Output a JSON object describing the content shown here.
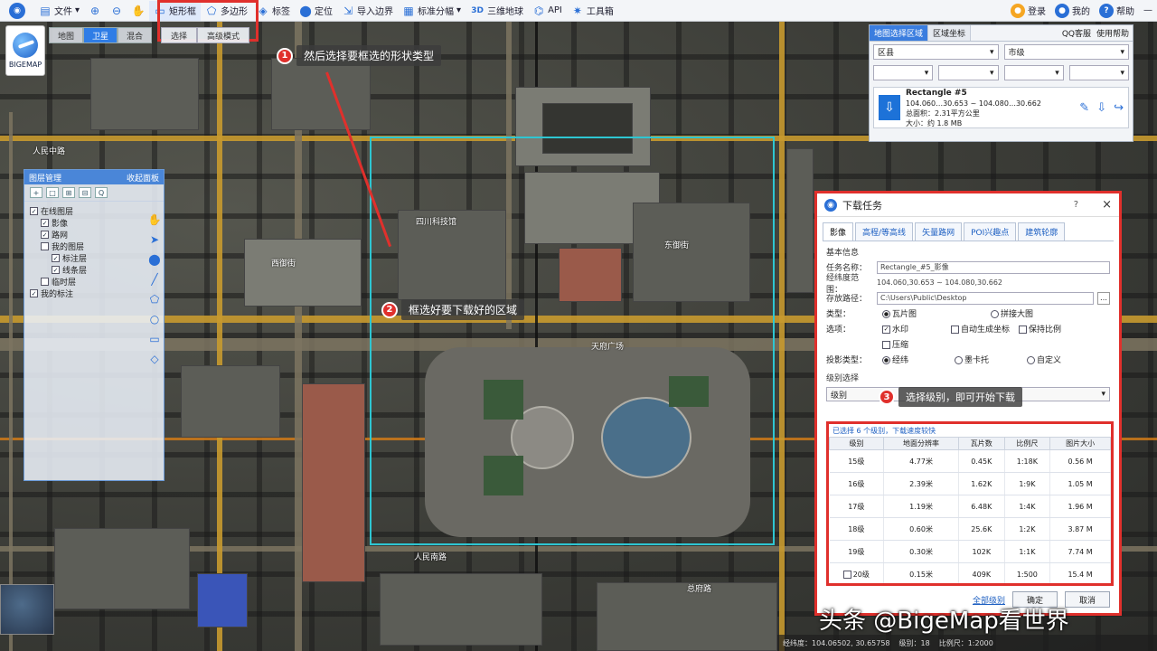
{
  "toolbar": {
    "items": [
      {
        "label": "文件",
        "icon": "folder-icon"
      },
      {
        "label": "",
        "icon": "zoom-in-icon"
      },
      {
        "label": "",
        "icon": "zoom-out-icon"
      },
      {
        "label": "",
        "icon": "hand-icon"
      },
      {
        "label": "矩形框",
        "icon": "rectangle-select-icon"
      },
      {
        "label": "多边形",
        "icon": "polygon-select-icon"
      },
      {
        "label": "标签",
        "icon": "tag-icon"
      },
      {
        "label": "定位",
        "icon": "location-icon"
      },
      {
        "label": "导入边界",
        "icon": "import-icon"
      },
      {
        "label": "标准分幅",
        "icon": "grid-icon"
      },
      {
        "label": "三维地球",
        "icon": "3d-icon"
      },
      {
        "label": "API",
        "icon": "api-icon"
      },
      {
        "label": "工具箱",
        "icon": "toolbox-icon"
      }
    ],
    "right": [
      {
        "label": "登录",
        "color": "#f5a623"
      },
      {
        "label": "我的",
        "color": "#2a6fd6"
      },
      {
        "label": "帮助",
        "color": "#2a6fd6"
      }
    ]
  },
  "maptype_tabs": [
    "地图",
    "卫星",
    "混合"
  ],
  "subtabs": [
    "选择",
    "高级模式"
  ],
  "logo": {
    "label": "BIGEMAP"
  },
  "callouts": {
    "c1": {
      "num": "1",
      "text": "然后选择要框选的形状类型"
    },
    "c2": {
      "num": "2",
      "text": "框选好要下载好的区域"
    },
    "c3": {
      "num": "3",
      "text": "选择级别，即可开始下载"
    }
  },
  "layer_panel": {
    "title": "图层管理",
    "right": "收起面板",
    "tools": [
      "+",
      "□",
      "⊞",
      "⊟",
      "Q"
    ],
    "tree": [
      {
        "label": "在线图层",
        "checked": true,
        "indent": 0
      },
      {
        "label": "影像",
        "checked": true,
        "indent": 1
      },
      {
        "label": "路网",
        "checked": true,
        "indent": 1
      },
      {
        "label": "我的图层",
        "checked": false,
        "indent": 1
      },
      {
        "label": "标注层",
        "checked": true,
        "indent": 2
      },
      {
        "label": "线条层",
        "checked": true,
        "indent": 2
      },
      {
        "label": "临时层",
        "checked": false,
        "indent": 1
      },
      {
        "label": "我的标注",
        "checked": true,
        "indent": 0
      }
    ]
  },
  "info_panel": {
    "tabs": [
      "地图选择区域",
      "区域坐标"
    ],
    "qq": "QQ客服",
    "help": "使用帮助",
    "sel1": "区县",
    "sel2": "市级",
    "file_title": "Rectangle #5",
    "file_line1": "104.060…30.653 ~ 104.080…30.662",
    "file_line2": "总面积：2.31平方公里",
    "file_line3": "大小：约 1.8 MB"
  },
  "dialog": {
    "title": "下载任务",
    "help": "?",
    "close": "×",
    "tabs": [
      "影像",
      "高程/等高线",
      "矢量路网",
      "POI兴趣点",
      "建筑轮廓"
    ],
    "section1": "基本信息",
    "name_label": "任务名称：",
    "name_value": "Rectangle_#5_影像",
    "range_label": "经纬度范围：",
    "range_value": "104.060,30.653 ~ 104.080,30.662",
    "path_label": "存放路径：",
    "path_value": "C:\\Users\\Public\\Desktop",
    "type_label": "类型：",
    "type_a": "瓦片图",
    "type_b": "拼接大图",
    "opt_label": "选项：",
    "opt_a": "水印",
    "opt_b": "自动生成坐标",
    "opt_c": "保持比例",
    "opt_d": "压缩",
    "proj_label": "投影类型：",
    "proj_a": "经纬",
    "proj_b": "墨卡托",
    "proj_c": "自定义",
    "section2": "级别选择",
    "level_combo": "级别",
    "note": "已选择 6 个级别，下载速度较快",
    "table_headers": [
      "级别",
      "地面分辨率",
      "瓦片数",
      "比例尺",
      "图片大小"
    ],
    "table_rows": [
      {
        "level": "15级",
        "res": "4.77米",
        "tiles": "0.45K",
        "scale": "1:18K",
        "size": "0.56 M"
      },
      {
        "level": "16级",
        "res": "2.39米",
        "tiles": "1.62K",
        "scale": "1:9K",
        "size": "1.05 M"
      },
      {
        "level": "17级",
        "res": "1.19米",
        "tiles": "6.48K",
        "scale": "1:4K",
        "size": "1.96 M"
      },
      {
        "level": "18级",
        "res": "0.60米",
        "tiles": "25.6K",
        "scale": "1:2K",
        "size": "3.87 M"
      },
      {
        "level": "19级",
        "res": "0.30米",
        "tiles": "102K",
        "scale": "1:1K",
        "size": "7.74 M"
      },
      {
        "level": "20级",
        "res": "0.15米",
        "tiles": "409K",
        "scale": "1:500",
        "size": "15.4 M"
      }
    ],
    "link": "全部级别",
    "ok": "确定",
    "cancel": "取消"
  },
  "map_labels": [
    "天府广场",
    "四川科技馆",
    "人民南路",
    "东御街",
    "西御街",
    "总府路",
    "人民中路"
  ],
  "statusbar": [
    "经纬度：104.06502, 30.65758",
    "级别：18",
    "比例尺：1:2000"
  ],
  "watermark": "头条 @BigeMap看世界"
}
